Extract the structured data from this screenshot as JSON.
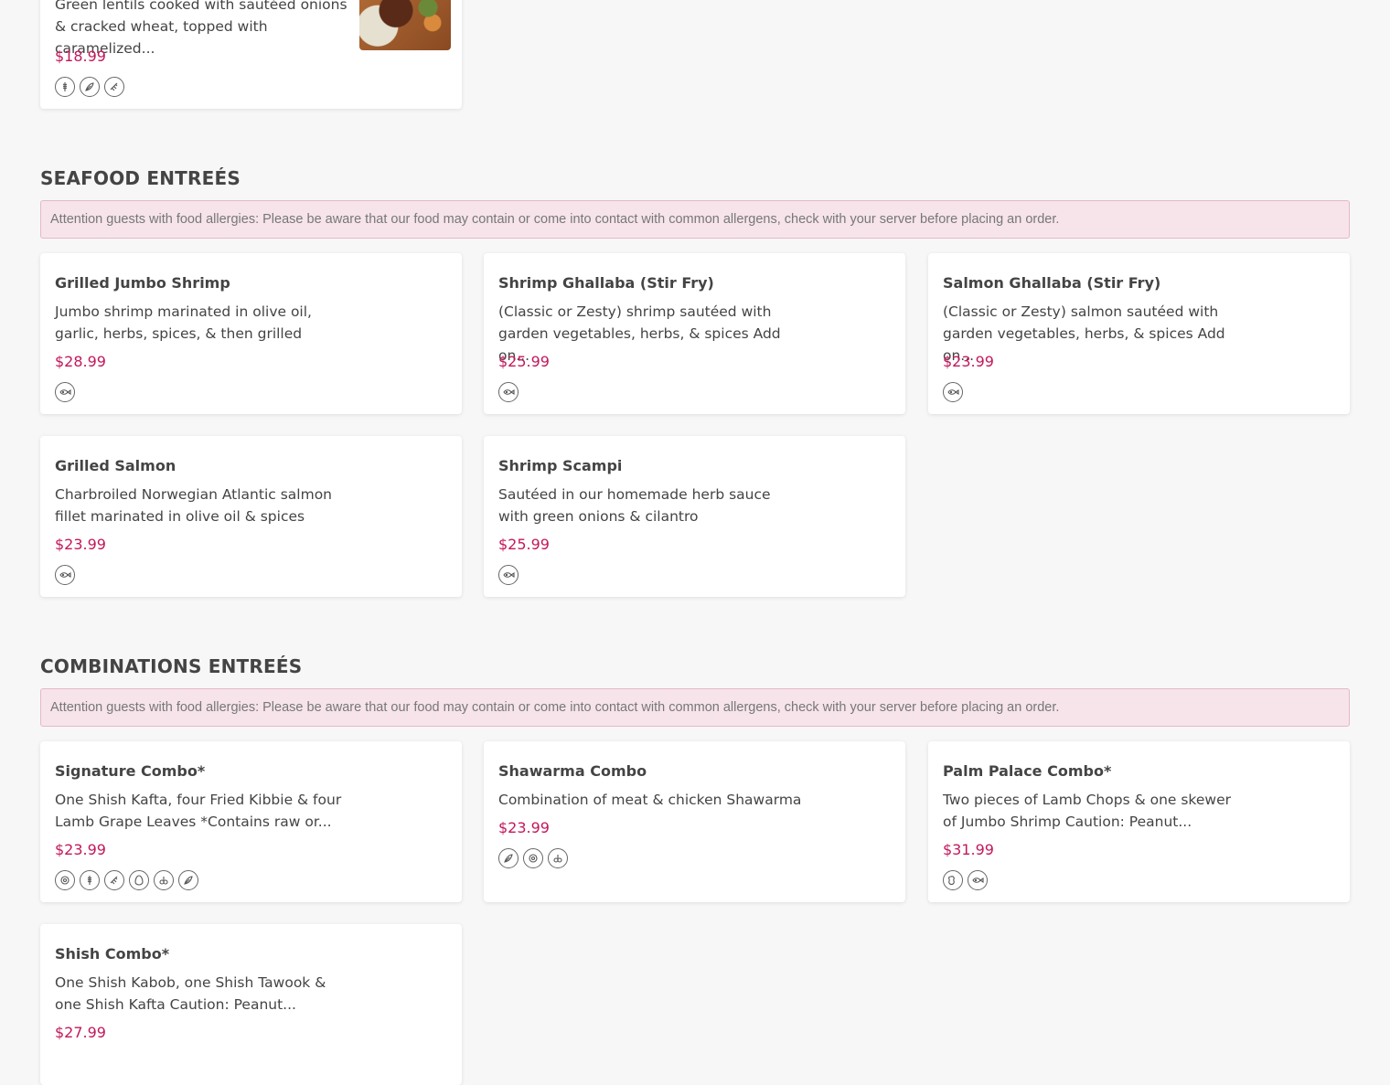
{
  "top_card": {
    "desc": "Green lentils cooked with sautéed onions & cracked wheat, topped with caramelized...",
    "price": "$18.99",
    "image_alt": "lentils dish photo",
    "icons": [
      "wheat-icon",
      "soy-icon",
      "sesame-icon"
    ]
  },
  "sections": [
    {
      "title": "SEAFOOD ENTREÉS",
      "notice": "Attention guests with food allergies: Please be aware that our food may contain or come into contact with common allergens, check with your server before placing an order.",
      "items": [
        {
          "name": "Grilled Jumbo Shrimp",
          "desc": "Jumbo shrimp marinated in olive oil, garlic, herbs, spices, & then grilled",
          "price": "$28.99",
          "icons": [
            "fish-icon"
          ]
        },
        {
          "name": "Shrimp Ghallaba (Stir Fry)",
          "desc": "(Classic or Zesty) shrimp sautéed with garden vegetables, herbs, & spices Add on...",
          "price": "$25.99",
          "icons": [
            "fish-icon"
          ]
        },
        {
          "name": "Salmon Ghallaba (Stir Fry)",
          "desc": "(Classic or Zesty) salmon sautéed with garden vegetables, herbs, & spices Add on...",
          "price": "$23.99",
          "icons": [
            "fish-icon"
          ]
        },
        {
          "name": "Grilled Salmon",
          "desc": "Charbroiled Norwegian Atlantic salmon fillet marinated in olive oil & spices",
          "price": "$23.99",
          "icons": [
            "fish-icon"
          ]
        },
        {
          "name": "Shrimp Scampi",
          "desc": "Sautéed in our homemade herb sauce with green onions & cilantro",
          "price": "$25.99",
          "icons": [
            "fish-icon"
          ]
        }
      ]
    },
    {
      "title": "COMBINATIONS ENTREÉS",
      "notice": "Attention guests with food allergies: Please be aware that our food may contain or come into contact with common allergens, check with your server before placing an order.",
      "items": [
        {
          "name": "Signature Combo*",
          "desc": "One Shish Kafta, four Fried Kibbie & four Lamb Grape Leaves  *Contains raw or...",
          "price": "$23.99",
          "icons": [
            "dairy-icon",
            "wheat-icon",
            "sesame-icon",
            "egg-icon",
            "tree-nut-icon",
            "soy-icon"
          ]
        },
        {
          "name": "Shawarma Combo",
          "desc": "Combination of meat & chicken Shawarma",
          "price": "$23.99",
          "icons": [
            "soy-icon",
            "dairy-icon",
            "tree-nut-icon"
          ]
        },
        {
          "name": "Palm Palace Combo*",
          "desc": "Two pieces of Lamb Chops & one skewer of Jumbo Shrimp  Caution: Peanut...",
          "price": "$31.99",
          "icons": [
            "peanut-icon",
            "fish-icon"
          ]
        },
        {
          "name": "Shish Combo*",
          "desc": "One Shish Kabob, one Shish Tawook & one Shish Kafta  Caution: Peanut...",
          "price": "$27.99",
          "icons": []
        }
      ]
    }
  ]
}
